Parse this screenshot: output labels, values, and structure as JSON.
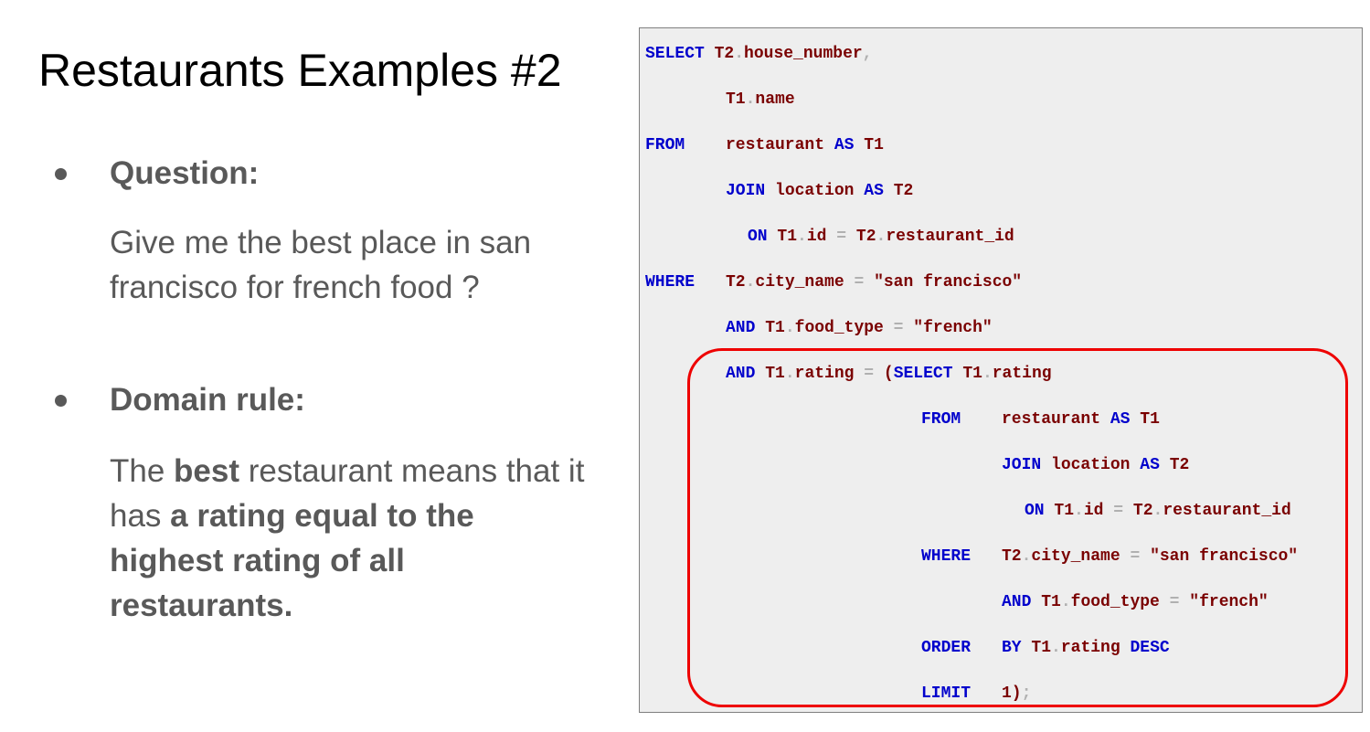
{
  "slide": {
    "title": "Restaurants Examples #2",
    "question_label": "Question:",
    "question_text": "Give me the best place in san francisco for french food ?",
    "rule_label": "Domain rule:",
    "rule_t1": "The ",
    "rule_b1": "best",
    "rule_t2": " restaurant means that it has ",
    "rule_b2": "a rating equal to the highest rating of all restaurants."
  },
  "code": {
    "l1_kw": "SELECT",
    "l1_a": "T2",
    "l1_b": "house_number",
    "l2_a": "T1",
    "l2_b": "name",
    "l3_kw": "FROM",
    "l3_a": "restaurant",
    "l3_kw2": "AS",
    "l3_b": "T1",
    "l4_kw": "JOIN",
    "l4_a": "location",
    "l4_kw2": "AS",
    "l4_b": "T2",
    "l5_kw": "ON",
    "l5_a": "T1",
    "l5_b": "id",
    "l5_c": "T2",
    "l5_d": "restaurant_id",
    "l6_kw": "WHERE",
    "l6_a": "T2",
    "l6_b": "city_name",
    "l6_s": "\"san francisco\"",
    "l7_kw": "AND",
    "l7_a": "T1",
    "l7_b": "food_type",
    "l7_s": "\"french\"",
    "l8_kw": "AND",
    "l8_a": "T1",
    "l8_b": "rating",
    "l8_p": "(",
    "l8_kw2": "SELECT",
    "l8_c": "T1",
    "l8_d": "rating",
    "l9_kw": "FROM",
    "l9_a": "restaurant",
    "l9_kw2": "AS",
    "l9_b": "T1",
    "l10_kw": "JOIN",
    "l10_a": "location",
    "l10_kw2": "AS",
    "l10_b": "T2",
    "l11_kw": "ON",
    "l11_a": "T1",
    "l11_b": "id",
    "l11_c": "T2",
    "l11_d": "restaurant_id",
    "l12_kw": "WHERE",
    "l12_a": "T2",
    "l12_b": "city_name",
    "l12_s": "\"san francisco\"",
    "l13_kw": "AND",
    "l13_a": "T1",
    "l13_b": "food_type",
    "l13_s": "\"french\"",
    "l14_kw": "ORDER",
    "l14_kw2": "BY",
    "l14_a": "T1",
    "l14_b": "rating",
    "l14_kw3": "DESC",
    "l15_kw": "LIMIT",
    "l15_a": "1)",
    "dot": ".",
    "eq": "=",
    "comma": ",",
    "semi": ";"
  },
  "colors": {
    "keyword": "#0000cc",
    "identifier": "#7a0000",
    "punctuation": "#b0b0b0",
    "highlight": "#ee0000",
    "code_bg": "#eeeeee",
    "body_text": "#595959"
  }
}
